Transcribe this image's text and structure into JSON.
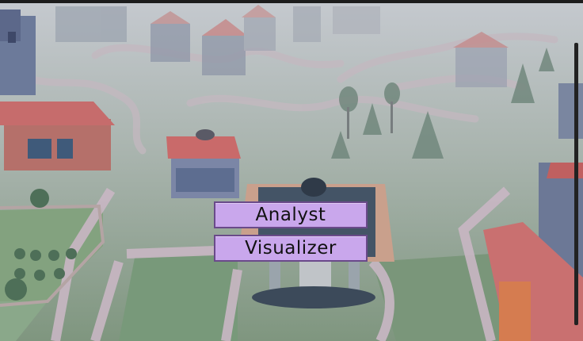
{
  "colors": {
    "fog": "#b4bcc2",
    "grass": "#8a9e8a",
    "path": "#c7b4bc",
    "roof": "#c06a6a",
    "wall": "#7d8aa6",
    "tree": "#5a7468",
    "button_fill": "#c9a7ec",
    "button_border": "#6a4a8a"
  },
  "menu": {
    "analyst_label": "Analyst",
    "visualizer_label": "Visualizer"
  }
}
